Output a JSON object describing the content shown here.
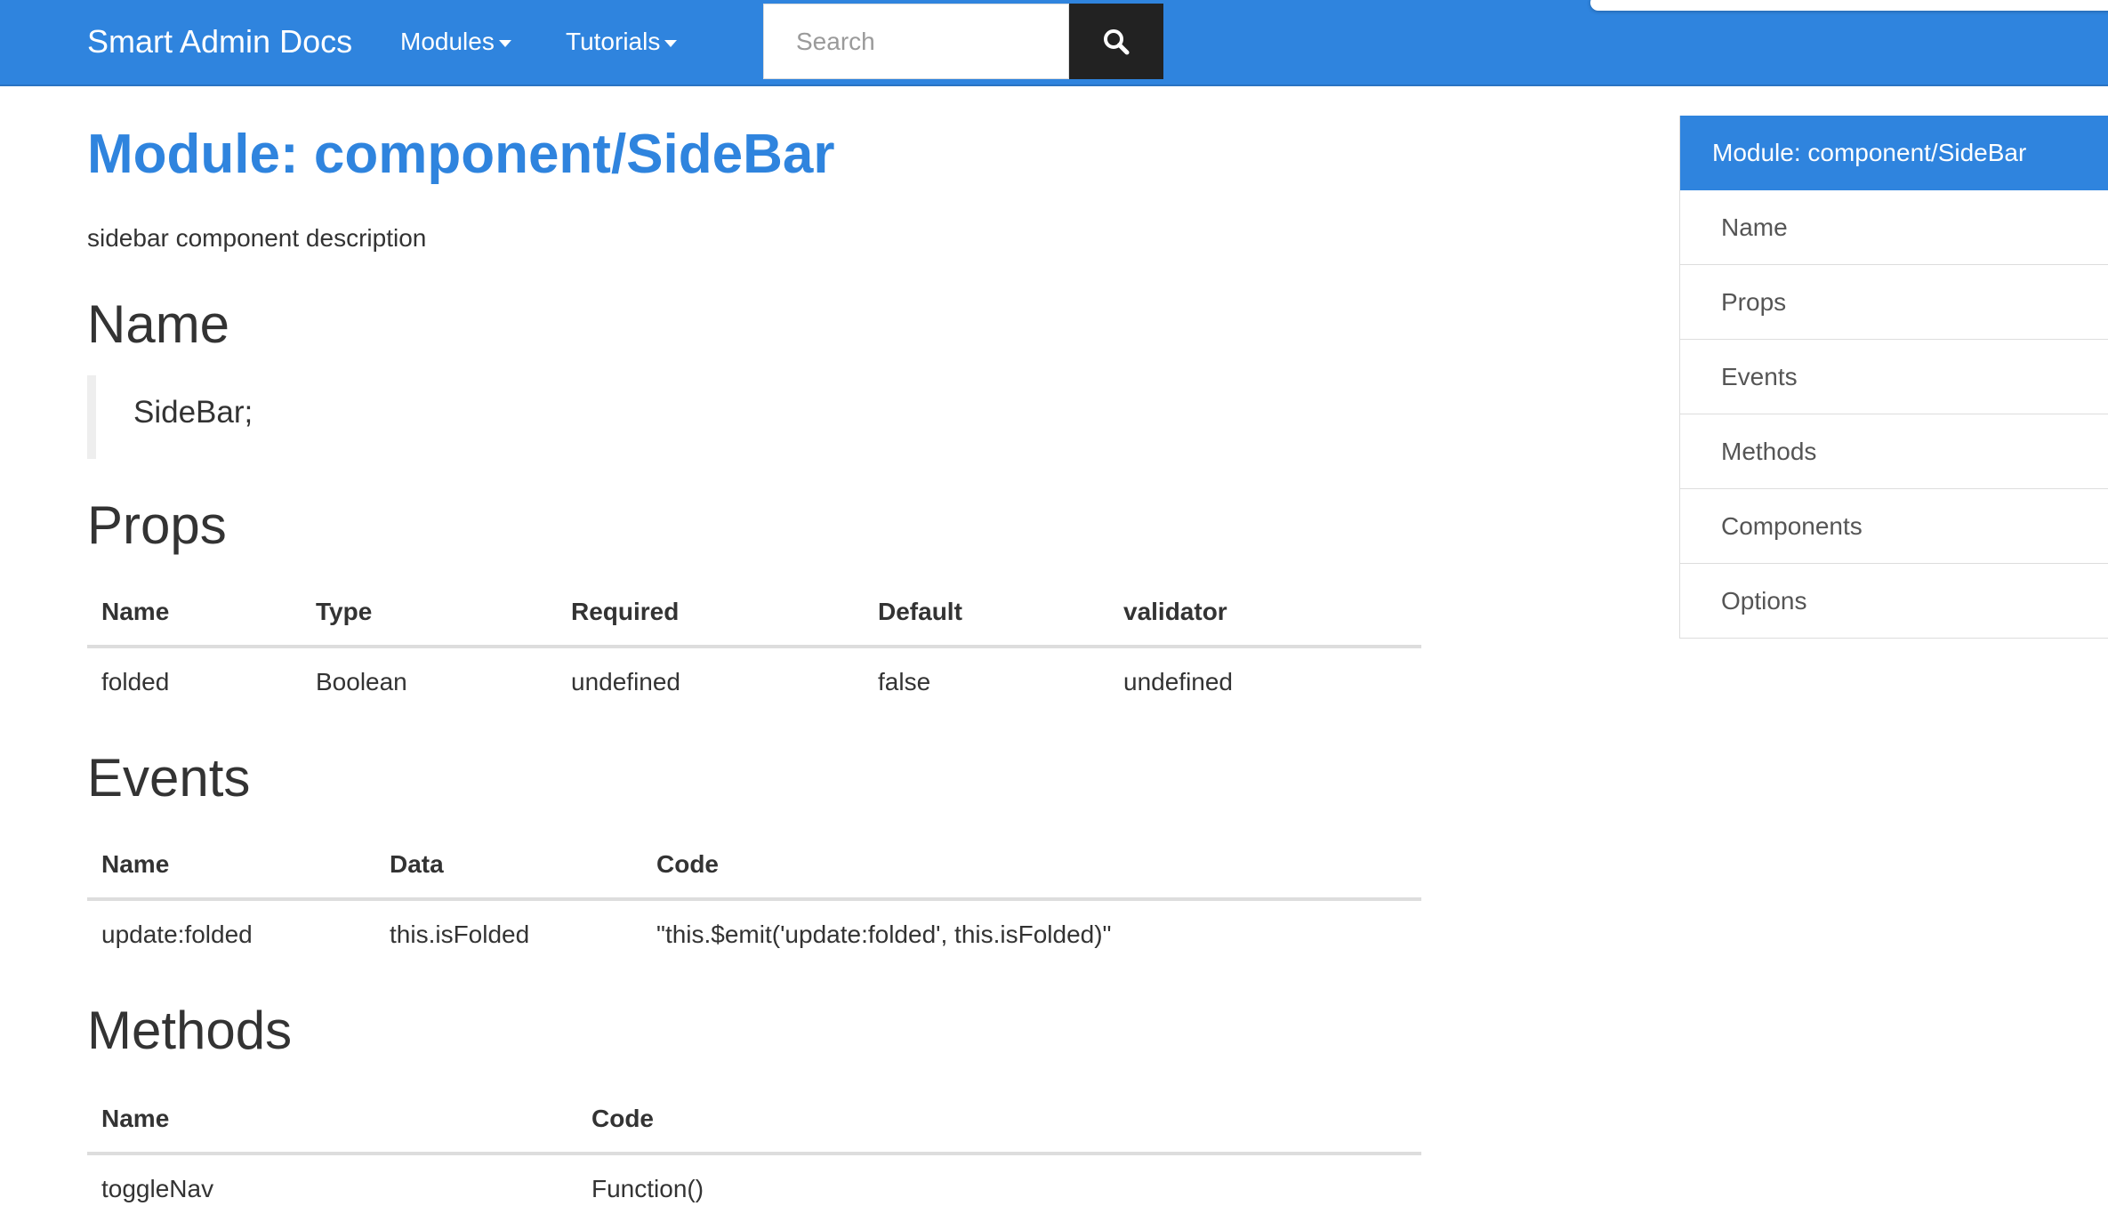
{
  "navbar": {
    "brand": "Smart Admin Docs",
    "menus": [
      "Modules",
      "Tutorials"
    ],
    "search_placeholder": "Search",
    "colors": {
      "primary": "#2f84de",
      "search_button": "#222222"
    }
  },
  "page": {
    "title": "Module: component/SideBar",
    "description": "sidebar component description"
  },
  "name_section": {
    "heading": "Name",
    "value": "SideBar;"
  },
  "props_section": {
    "heading": "Props",
    "columns": [
      "Name",
      "Type",
      "Required",
      "Default",
      "validator"
    ],
    "rows": [
      [
        "folded",
        "Boolean",
        "undefined",
        "false",
        "undefined"
      ]
    ]
  },
  "events_section": {
    "heading": "Events",
    "columns": [
      "Name",
      "Data",
      "Code"
    ],
    "rows": [
      [
        "update:folded",
        "this.isFolded",
        "\"this.$emit('update:folded', this.isFolded)\""
      ]
    ]
  },
  "methods_section": {
    "heading": "Methods",
    "columns": [
      "Name",
      "Code"
    ],
    "rows": [
      [
        "toggleNav",
        "Function()"
      ]
    ]
  },
  "toc": {
    "header": "Module: component/SideBar",
    "items": [
      "Name",
      "Props",
      "Events",
      "Methods",
      "Components",
      "Options"
    ]
  }
}
